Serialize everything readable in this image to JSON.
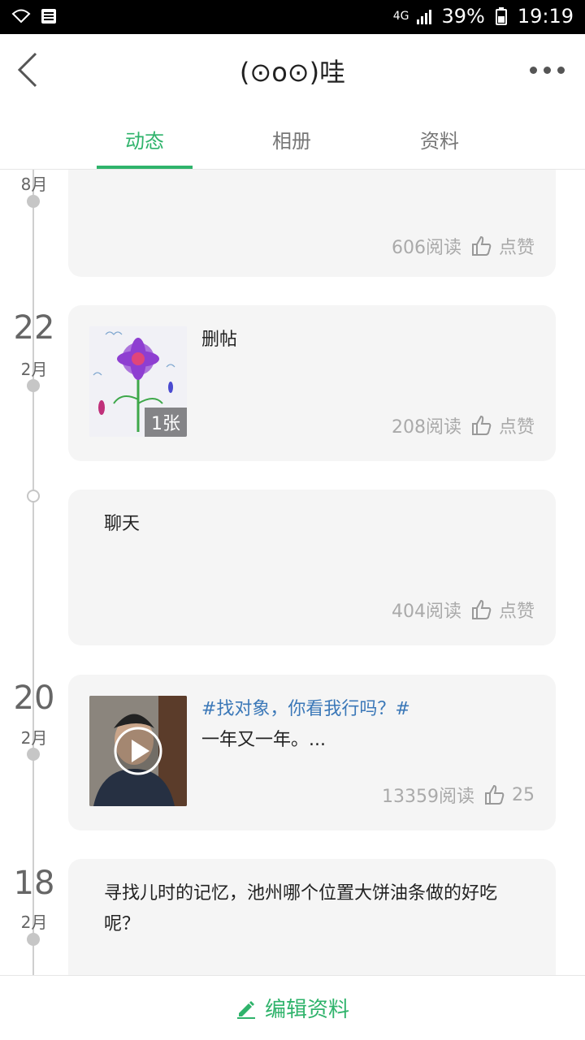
{
  "status_bar": {
    "network": "4G",
    "battery": "39%",
    "time": "19:19"
  },
  "header": {
    "title": "(⊙o⊙)哇"
  },
  "tabs": [
    "动态",
    "相册",
    "资料"
  ],
  "timeline": {
    "top_group": {
      "month": "8月",
      "reads": "606阅读",
      "like": "点赞"
    },
    "groups": [
      {
        "day": "22",
        "month": "2月",
        "text": "删帖",
        "photo_count": "1张",
        "reads": "208阅读",
        "like": "点赞"
      },
      {
        "text": "聊天",
        "reads": "404阅读",
        "like": "点赞"
      },
      {
        "day": "20",
        "month": "2月",
        "tag": "#找对象，你看我行吗？#",
        "text": "一年又一年。...",
        "reads": "13359阅读",
        "likes": "25"
      },
      {
        "day": "18",
        "month": "2月",
        "text_line1": "寻找儿时的记忆，池州哪个位置大饼油条做的好吃",
        "text_line2": "呢？"
      }
    ]
  },
  "footer": {
    "edit_profile": "编辑资料"
  },
  "colors": {
    "accent": "#2fb36b",
    "tag": "#3b78b8",
    "card_bg": "#f5f5f5"
  },
  "icons": [
    "back-arrow-icon",
    "more-icon",
    "thumbs-up-icon",
    "pencil-icon",
    "play-icon"
  ]
}
